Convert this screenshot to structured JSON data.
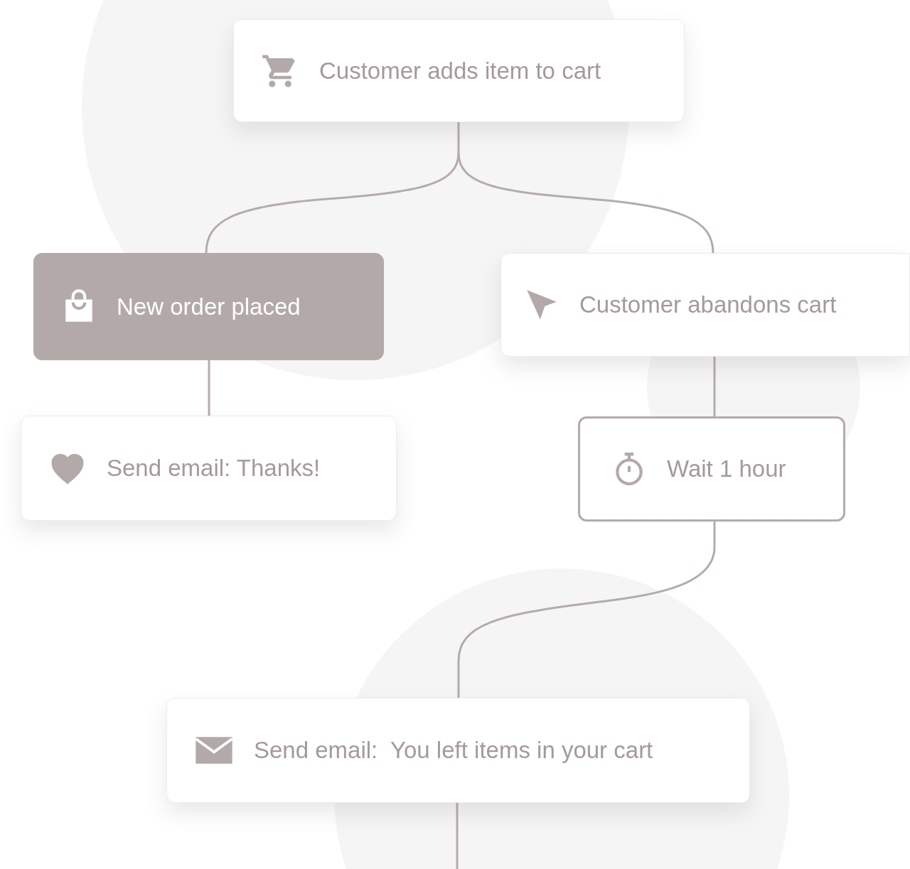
{
  "nodes": [
    {
      "kind": "cart",
      "label": "Customer adds item to cart",
      "selected": false
    },
    {
      "kind": "order",
      "label": "New order placed",
      "selected": true
    },
    {
      "kind": "abandon",
      "label": "Customer abandons cart",
      "selected": false
    },
    {
      "kind": "thanks",
      "label": "Send email: Thanks!",
      "selected": false
    },
    {
      "kind": "wait",
      "label": "Wait 1 hour",
      "selected": false
    },
    {
      "kind": "reminder",
      "label": "Send email:  You left items in your cart",
      "selected": false
    }
  ]
}
